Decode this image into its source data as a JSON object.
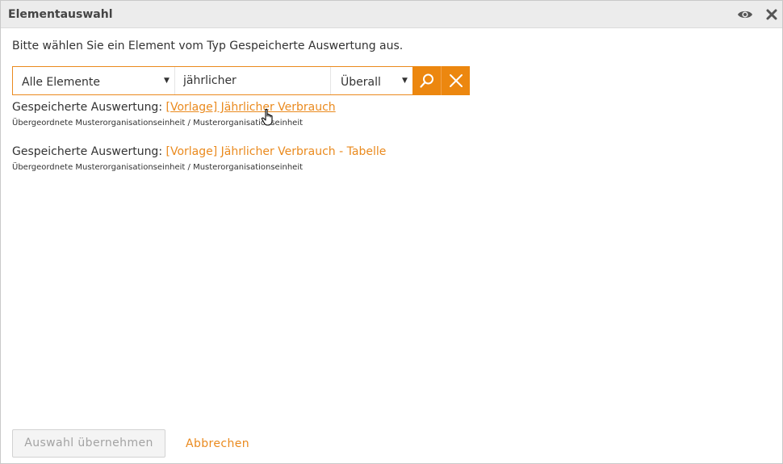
{
  "dialog": {
    "title": "Elementauswahl",
    "header_icons": [
      "eye-icon",
      "close-icon"
    ]
  },
  "instruction": "Bitte wählen Sie ein Element vom Typ Gespeicherte Auswertung aus.",
  "search": {
    "scope_value": "Alle Elemente",
    "query_value": "jährlicher",
    "where_value": "Überall",
    "search_icon": "search-icon",
    "clear_icon": "clear-icon"
  },
  "results": [
    {
      "type_label": "Gespeicherte Auswertung: ",
      "name": "[Vorlage] Jährlicher Verbrauch",
      "path": "Übergeordnete Musterorganisationseinheit / Musterorganisationseinheit"
    },
    {
      "type_label": "Gespeicherte Auswertung: ",
      "name": "[Vorlage] Jährlicher Verbrauch - Tabelle",
      "path": "Übergeordnete Musterorganisationseinheit / Musterorganisationseinheit"
    }
  ],
  "footer": {
    "apply_label": "Auswahl übernehmen",
    "cancel_label": "Abbrechen"
  },
  "colors": {
    "accent": "#ec870f",
    "link": "#ea8a1e",
    "text": "#333333",
    "titlebar": "#ececec"
  }
}
